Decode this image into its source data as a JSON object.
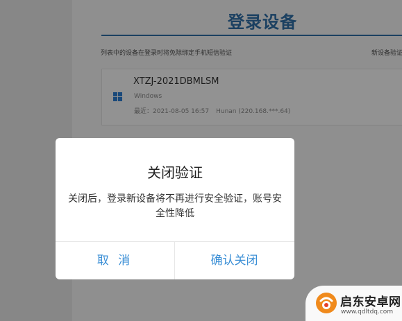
{
  "page": {
    "title": "登录设备",
    "description": "列表中的设备在登录时将免除绑定手机短信验证",
    "right_link": "新设备验证",
    "accent_color": "#2f6fa8"
  },
  "device": {
    "name": "XTZJ-2021DBMLSM",
    "os": "Windows",
    "last_login": "最近：2021-08-05 16:57",
    "location": "Hunan (220.168.***.64)",
    "icon": "windows-icon"
  },
  "dialog": {
    "title": "关闭验证",
    "message": "关闭后，登录新设备将不再进行安全验证，账号安全性降低",
    "cancel_label": "取 消",
    "confirm_label": "确认关闭",
    "button_color": "#3b8fd6"
  },
  "watermark": {
    "brand": "启东安卓网",
    "url": "www.qdltdq.com"
  }
}
